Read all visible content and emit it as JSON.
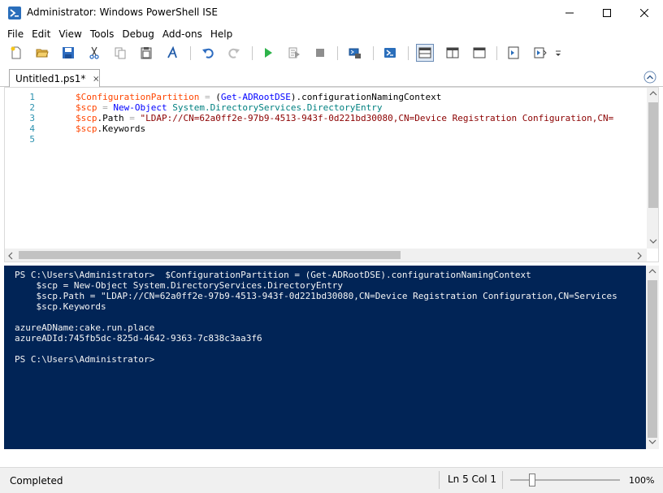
{
  "window": {
    "title": "Administrator: Windows PowerShell ISE"
  },
  "menu": [
    "File",
    "Edit",
    "View",
    "Tools",
    "Debug",
    "Add-ons",
    "Help"
  ],
  "tab": {
    "label": "Untitled1.ps1*"
  },
  "editor": {
    "lines": [
      {
        "num": "1",
        "tokens": [
          {
            "t": "var",
            "v": "$ConfigurationPartition"
          },
          {
            "t": "op",
            "v": " = "
          },
          {
            "t": "txt",
            "v": "("
          },
          {
            "t": "cmd",
            "v": "Get-ADRootDSE"
          },
          {
            "t": "txt",
            "v": ")."
          },
          {
            "t": "mem",
            "v": "configurationNamingContext"
          }
        ]
      },
      {
        "num": "2",
        "tokens": [
          {
            "t": "var",
            "v": "$scp"
          },
          {
            "t": "op",
            "v": " = "
          },
          {
            "t": "cmd",
            "v": "New-Object"
          },
          {
            "t": "txt",
            "v": " "
          },
          {
            "t": "type",
            "v": "System.DirectoryServices.DirectoryEntry"
          }
        ]
      },
      {
        "num": "3",
        "tokens": [
          {
            "t": "var",
            "v": "$scp"
          },
          {
            "t": "txt",
            "v": "."
          },
          {
            "t": "mem",
            "v": "Path"
          },
          {
            "t": "op",
            "v": " = "
          },
          {
            "t": "str",
            "v": "\"LDAP://CN=62a0ff2e-97b9-4513-943f-0d221bd30080,CN=Device Registration Configuration,CN="
          }
        ]
      },
      {
        "num": "4",
        "tokens": [
          {
            "t": "var",
            "v": "$scp"
          },
          {
            "t": "txt",
            "v": "."
          },
          {
            "t": "mem",
            "v": "Keywords"
          }
        ]
      },
      {
        "num": "5",
        "tokens": []
      }
    ]
  },
  "console": {
    "lines": [
      "PS C:\\Users\\Administrator>  $ConfigurationPartition = (Get-ADRootDSE).configurationNamingContext",
      "    $scp = New-Object System.DirectoryServices.DirectoryEntry",
      "    $scp.Path = \"LDAP://CN=62a0ff2e-97b9-4513-943f-0d221bd30080,CN=Device Registration Configuration,CN=Services",
      "    $scp.Keywords",
      "",
      "azureADName:cake.run.place",
      "azureADId:745fb5dc-825d-4642-9363-7c838c3aa3f6",
      "",
      "PS C:\\Users\\Administrator>"
    ]
  },
  "status": {
    "text": "Completed",
    "position": "Ln 5  Col 1",
    "zoom": "100%",
    "zoom_level": 0.2
  },
  "icons": {
    "app": "powershell-icon",
    "toolbar": [
      "new-file-icon",
      "open-folder-icon",
      "save-icon",
      "cut-icon",
      "copy-icon",
      "paste-icon",
      "clear-console-icon",
      "undo-icon",
      "redo-icon",
      "run-script-icon",
      "run-selection-icon",
      "stop-icon",
      "remote-powershell-tab-icon",
      "start-powershell-icon",
      "show-script-pane-top-icon",
      "show-script-pane-right-icon",
      "show-script-pane-maximized-icon",
      "show-command-window-icon",
      "show-command-addon-icon",
      "toolbar-overflow-icon"
    ]
  },
  "colors": {
    "console_background": "#012456",
    "variable": "#ff4500",
    "command": "#0000ff",
    "string": "#8b0000",
    "type": "#008080",
    "line_number": "#2b91af"
  }
}
